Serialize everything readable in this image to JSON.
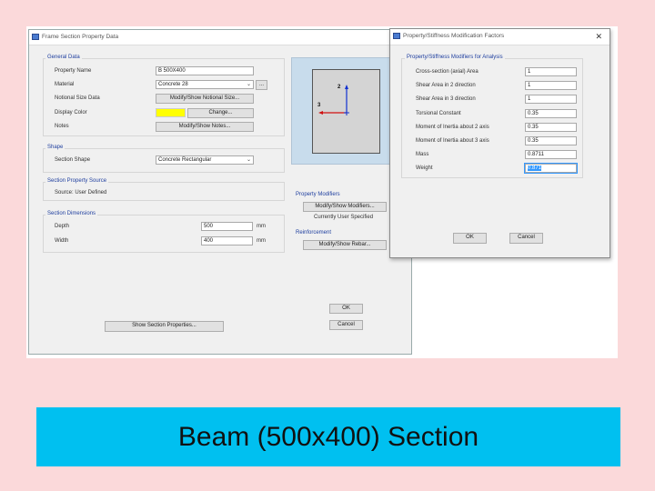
{
  "frame_dialog": {
    "title": "Frame Section Property Data",
    "general_data": {
      "group_title": "General Data",
      "property_name_label": "Property Name",
      "property_name_value": "B 500X400",
      "material_label": "Material",
      "material_value": "Concrete 28",
      "material_more_button": "...",
      "notional_size_label": "Notional Size Data",
      "notional_size_button": "Modify/Show Notional Size...",
      "display_color_label": "Display Color",
      "display_color_value": "#ffff00",
      "change_button": "Change...",
      "notes_label": "Notes",
      "notes_button": "Modify/Show Notes..."
    },
    "shape": {
      "group_title": "Shape",
      "section_shape_label": "Section Shape",
      "section_shape_value": "Concrete Rectangular"
    },
    "property_source": {
      "group_title": "Section Property Source",
      "source_text": "Source: User Defined"
    },
    "dimensions": {
      "group_title": "Section Dimensions",
      "depth_label": "Depth",
      "depth_value": "500",
      "depth_unit": "mm",
      "width_label": "Width",
      "width_value": "400",
      "width_unit": "mm"
    },
    "preview": {
      "axis_2": "2",
      "axis_3": "3"
    },
    "property_modifiers": {
      "group_title": "Property Modifiers",
      "modify_button": "Modify/Show Modifiers...",
      "status": "Currently User Specified"
    },
    "reinforcement": {
      "group_title": "Reinforcement",
      "rebar_button": "Modify/Show Rebar..."
    },
    "show_properties_button": "Show Section Properties...",
    "ok_button": "OK",
    "cancel_button": "Cancel"
  },
  "modifiers_dialog": {
    "title": "Property/Stiffness Modification Factors",
    "close_glyph": "✕",
    "group_title": "Property/Stiffness Modifiers for Analysis",
    "rows": [
      {
        "label": "Cross-section (axial) Area",
        "value": "1"
      },
      {
        "label": "Shear Area in 2 direction",
        "value": "1"
      },
      {
        "label": "Shear Area in 3 direction",
        "value": "1"
      },
      {
        "label": "Torsional Constant",
        "value": "0.35"
      },
      {
        "label": "Moment of Inertia about 2 axis",
        "value": "0.35"
      },
      {
        "label": "Moment of Inertia about 3 axis",
        "value": "0.35"
      },
      {
        "label": "Mass",
        "value": "0.8711"
      },
      {
        "label": "Weight",
        "value": "0.871"
      }
    ],
    "ok_button": "OK",
    "cancel_button": "Cancel"
  },
  "caption": "Beam (500x400) Section",
  "colors": {
    "slide_background": "#fbd9da",
    "caption_bar": "#00c0f0",
    "group_title": "#1f3f9f"
  }
}
